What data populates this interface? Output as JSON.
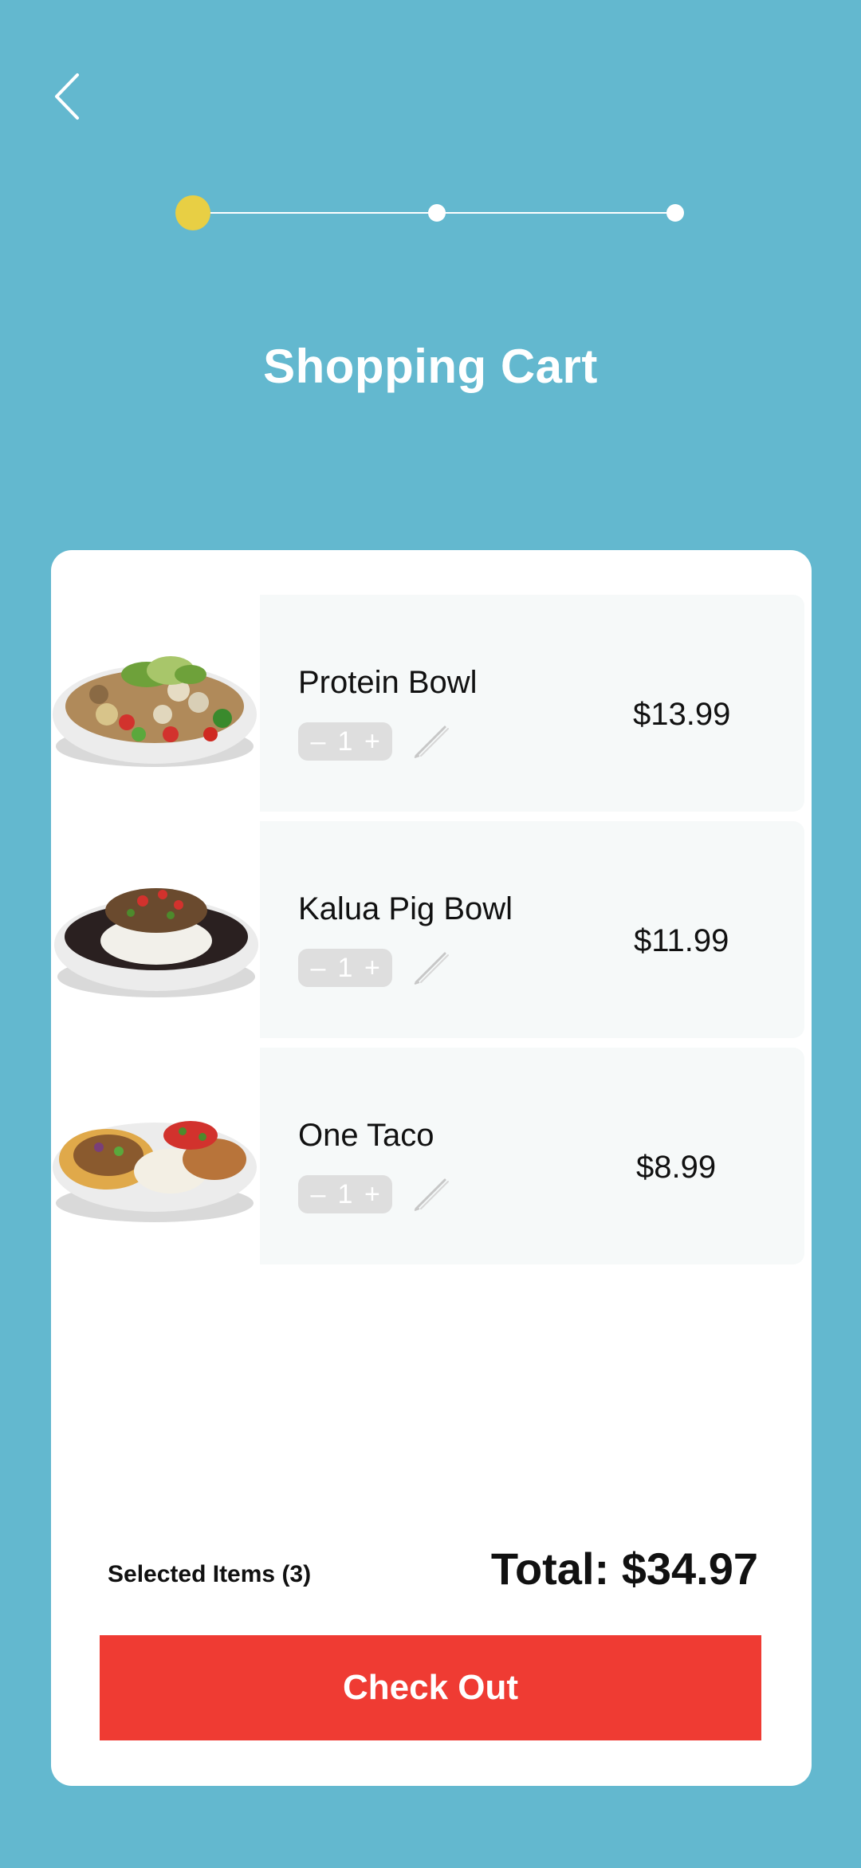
{
  "header": {
    "back_icon": "chevron-left-icon",
    "title": "Shopping Cart"
  },
  "progress": {
    "steps": 3,
    "current_step": 1,
    "active_color": "#e8cf44"
  },
  "cart": {
    "items": [
      {
        "name": "Protein Bowl",
        "quantity": "1",
        "price": "$13.99",
        "minus": "–",
        "plus": "+"
      },
      {
        "name": "Kalua Pig Bowl",
        "quantity": "1",
        "price": "$11.99",
        "minus": "–",
        "plus": "+"
      },
      {
        "name": "One Taco",
        "quantity": "1",
        "price": "$8.99",
        "minus": "–",
        "plus": "+"
      }
    ],
    "selected_items_label": "Selected Items (3)",
    "total_label": "Total: $34.97",
    "checkout_label": "Check Out"
  },
  "colors": {
    "background": "#63b8cf",
    "checkout_button": "#ef3b33",
    "card": "#ffffff"
  }
}
